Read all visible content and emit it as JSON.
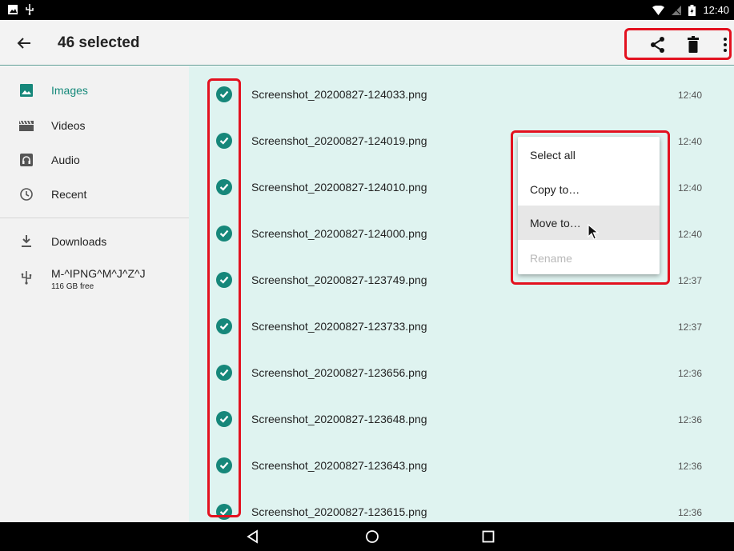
{
  "status_bar": {
    "time": "12:40"
  },
  "app_bar": {
    "title": "46 selected"
  },
  "sidebar": {
    "roots": [
      {
        "label": "Images",
        "icon": "image-icon"
      },
      {
        "label": "Videos",
        "icon": "video-icon"
      },
      {
        "label": "Audio",
        "icon": "audio-icon"
      },
      {
        "label": "Recent",
        "icon": "clock-icon"
      }
    ],
    "storage": [
      {
        "label": "Downloads",
        "icon": "download-icon"
      },
      {
        "label": "M-^IPNG^M^J^Z^J",
        "sub": "116 GB free",
        "icon": "usb-icon"
      }
    ]
  },
  "files": [
    {
      "name": "Screenshot_20200827-124033.png",
      "time": "12:40"
    },
    {
      "name": "Screenshot_20200827-124019.png",
      "time": "12:40"
    },
    {
      "name": "Screenshot_20200827-124010.png",
      "time": "12:40"
    },
    {
      "name": "Screenshot_20200827-124000.png",
      "time": "12:40"
    },
    {
      "name": "Screenshot_20200827-123749.png",
      "time": "12:37"
    },
    {
      "name": "Screenshot_20200827-123733.png",
      "time": "12:37"
    },
    {
      "name": "Screenshot_20200827-123656.png",
      "time": "12:36"
    },
    {
      "name": "Screenshot_20200827-123648.png",
      "time": "12:36"
    },
    {
      "name": "Screenshot_20200827-123643.png",
      "time": "12:36"
    },
    {
      "name": "Screenshot_20200827-123615.png",
      "time": "12:36"
    }
  ],
  "menu": {
    "select_all": "Select all",
    "copy_to": "Copy to…",
    "move_to": "Move to…",
    "rename": "Rename"
  },
  "colors": {
    "accent": "#16877a",
    "selected_bg": "#dff3f0",
    "highlight": "#e3111f"
  }
}
